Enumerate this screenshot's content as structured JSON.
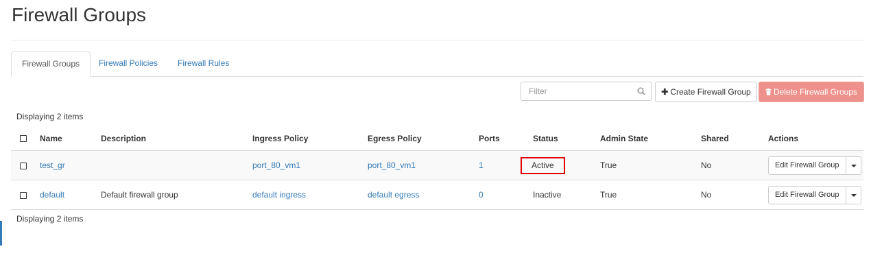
{
  "page": {
    "title": "Firewall Groups"
  },
  "tabs": [
    {
      "label": "Firewall Groups",
      "active": true
    },
    {
      "label": "Firewall Policies",
      "active": false
    },
    {
      "label": "Firewall Rules",
      "active": false
    }
  ],
  "toolbar": {
    "filter_placeholder": "Filter",
    "create_label": "Create Firewall Group",
    "create_icon": "plus-icon",
    "delete_label": "Delete Firewall Groups",
    "delete_icon": "trash-icon"
  },
  "table": {
    "count_text": "Displaying 2 items",
    "columns": [
      "Name",
      "Description",
      "Ingress Policy",
      "Egress Policy",
      "Ports",
      "Status",
      "Admin State",
      "Shared",
      "Actions"
    ],
    "rows": [
      {
        "name": "test_gr",
        "description": "",
        "ingress_policy": "port_80_vm1",
        "egress_policy": "port_80_vm1",
        "ports": "1",
        "status": "Active",
        "admin_state": "True",
        "shared": "No",
        "action": "Edit Firewall Group"
      },
      {
        "name": "default",
        "description": "Default firewall group",
        "ingress_policy": "default ingress",
        "egress_policy": "default egress",
        "ports": "0",
        "status": "Inactive",
        "admin_state": "True",
        "shared": "No",
        "action": "Edit Firewall Group"
      }
    ]
  },
  "colors": {
    "link": "#337ab7",
    "danger_button": "#ee908b",
    "highlight_box": "#e00000"
  }
}
